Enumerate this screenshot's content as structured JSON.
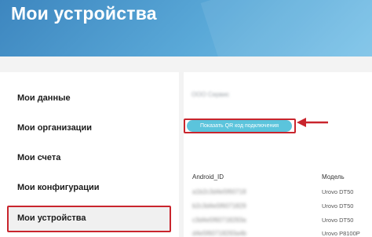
{
  "header": {
    "title": "Мои устройства"
  },
  "sidebar": {
    "items": [
      {
        "label": "Мои данные"
      },
      {
        "label": "Мои организации"
      },
      {
        "label": "Мои счета"
      },
      {
        "label": "Мои конфигурации"
      },
      {
        "label": "Мои устройства",
        "active": true
      }
    ]
  },
  "main": {
    "select_value": "ООО Сервис",
    "qr_button_label": "Показать QR код подключения",
    "table": {
      "columns": [
        "Android_ID",
        "Модель"
      ],
      "rows": [
        {
          "android_id": "a1b2c3d4e5f60718",
          "model": "Urovo DT50"
        },
        {
          "android_id": "b2c3d4e5f6071829",
          "model": "Urovo DT50"
        },
        {
          "android_id": "c3d4e5f60718293a",
          "model": "Urovo DT50"
        },
        {
          "android_id": "d4e5f60718293a4b",
          "model": "Urovo P8100P"
        }
      ]
    }
  },
  "colors": {
    "accent": "#5bc4dc",
    "highlight": "#c9252d",
    "header": "#4a97cc"
  }
}
